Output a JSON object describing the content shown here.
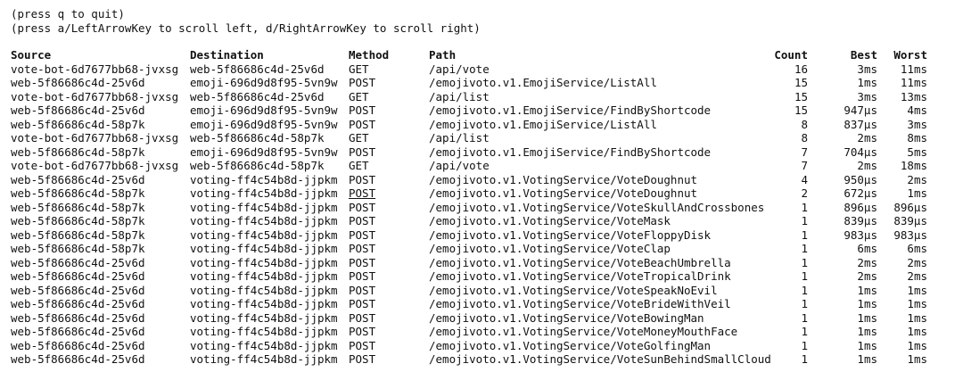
{
  "hints": [
    "(press q to quit)",
    "(press a/LeftArrowKey to scroll left, d/RightArrowKey to scroll right)"
  ],
  "headers": {
    "source": "Source",
    "destination": "Destination",
    "method": "Method",
    "path": "Path",
    "count": "Count",
    "best": "Best",
    "worst": "Worst"
  },
  "rows": [
    {
      "source": "vote-bot-6d7677bb68-jvxsg",
      "destination": "web-5f86686c4d-25v6d",
      "method": "GET",
      "path": "/api/vote",
      "count": "16",
      "best": "3ms",
      "worst": "11ms"
    },
    {
      "source": "web-5f86686c4d-25v6d",
      "destination": "emoji-696d9d8f95-5vn9w",
      "method": "POST",
      "path": "/emojivoto.v1.EmojiService/ListAll",
      "count": "15",
      "best": "1ms",
      "worst": "11ms"
    },
    {
      "source": "vote-bot-6d7677bb68-jvxsg",
      "destination": "web-5f86686c4d-25v6d",
      "method": "GET",
      "path": "/api/list",
      "count": "15",
      "best": "3ms",
      "worst": "13ms"
    },
    {
      "source": "web-5f86686c4d-25v6d",
      "destination": "emoji-696d9d8f95-5vn9w",
      "method": "POST",
      "path": "/emojivoto.v1.EmojiService/FindByShortcode",
      "count": "15",
      "best": "947µs",
      "worst": "4ms"
    },
    {
      "source": "web-5f86686c4d-58p7k",
      "destination": "emoji-696d9d8f95-5vn9w",
      "method": "POST",
      "path": "/emojivoto.v1.EmojiService/ListAll",
      "count": "8",
      "best": "837µs",
      "worst": "3ms"
    },
    {
      "source": "vote-bot-6d7677bb68-jvxsg",
      "destination": "web-5f86686c4d-58p7k",
      "method": "GET",
      "path": "/api/list",
      "count": "8",
      "best": "2ms",
      "worst": "8ms"
    },
    {
      "source": "web-5f86686c4d-58p7k",
      "destination": "emoji-696d9d8f95-5vn9w",
      "method": "POST",
      "path": "/emojivoto.v1.EmojiService/FindByShortcode",
      "count": "7",
      "best": "704µs",
      "worst": "5ms"
    },
    {
      "source": "vote-bot-6d7677bb68-jvxsg",
      "destination": "web-5f86686c4d-58p7k",
      "method": "GET",
      "path": "/api/vote",
      "count": "7",
      "best": "2ms",
      "worst": "18ms"
    },
    {
      "source": "web-5f86686c4d-25v6d",
      "destination": "voting-ff4c54b8d-jjpkm",
      "method": "POST",
      "path": "/emojivoto.v1.VotingService/VoteDoughnut",
      "count": "4",
      "best": "950µs",
      "worst": "2ms"
    },
    {
      "source": "web-5f86686c4d-58p7k",
      "destination": "voting-ff4c54b8d-jjpkm",
      "method": "POST",
      "path": "/emojivoto.v1.VotingService/VoteDoughnut",
      "count": "2",
      "best": "672µs",
      "worst": "1ms"
    },
    {
      "source": "web-5f86686c4d-58p7k",
      "destination": "voting-ff4c54b8d-jjpkm",
      "method": "POST",
      "path": "/emojivoto.v1.VotingService/VoteSkullAndCrossbones",
      "count": "1",
      "best": "896µs",
      "worst": "896µs"
    },
    {
      "source": "web-5f86686c4d-58p7k",
      "destination": "voting-ff4c54b8d-jjpkm",
      "method": "POST",
      "path": "/emojivoto.v1.VotingService/VoteMask",
      "count": "1",
      "best": "839µs",
      "worst": "839µs"
    },
    {
      "source": "web-5f86686c4d-58p7k",
      "destination": "voting-ff4c54b8d-jjpkm",
      "method": "POST",
      "path": "/emojivoto.v1.VotingService/VoteFloppyDisk",
      "count": "1",
      "best": "983µs",
      "worst": "983µs"
    },
    {
      "source": "web-5f86686c4d-58p7k",
      "destination": "voting-ff4c54b8d-jjpkm",
      "method": "POST",
      "path": "/emojivoto.v1.VotingService/VoteClap",
      "count": "1",
      "best": "6ms",
      "worst": "6ms"
    },
    {
      "source": "web-5f86686c4d-25v6d",
      "destination": "voting-ff4c54b8d-jjpkm",
      "method": "POST",
      "path": "/emojivoto.v1.VotingService/VoteBeachUmbrella",
      "count": "1",
      "best": "2ms",
      "worst": "2ms"
    },
    {
      "source": "web-5f86686c4d-25v6d",
      "destination": "voting-ff4c54b8d-jjpkm",
      "method": "POST",
      "path": "/emojivoto.v1.VotingService/VoteTropicalDrink",
      "count": "1",
      "best": "2ms",
      "worst": "2ms"
    },
    {
      "source": "web-5f86686c4d-25v6d",
      "destination": "voting-ff4c54b8d-jjpkm",
      "method": "POST",
      "path": "/emojivoto.v1.VotingService/VoteSpeakNoEvil",
      "count": "1",
      "best": "1ms",
      "worst": "1ms"
    },
    {
      "source": "web-5f86686c4d-25v6d",
      "destination": "voting-ff4c54b8d-jjpkm",
      "method": "POST",
      "path": "/emojivoto.v1.VotingService/VoteBrideWithVeil",
      "count": "1",
      "best": "1ms",
      "worst": "1ms"
    },
    {
      "source": "web-5f86686c4d-25v6d",
      "destination": "voting-ff4c54b8d-jjpkm",
      "method": "POST",
      "path": "/emojivoto.v1.VotingService/VoteBowingMan",
      "count": "1",
      "best": "1ms",
      "worst": "1ms"
    },
    {
      "source": "web-5f86686c4d-25v6d",
      "destination": "voting-ff4c54b8d-jjpkm",
      "method": "POST",
      "path": "/emojivoto.v1.VotingService/VoteMoneyMouthFace",
      "count": "1",
      "best": "1ms",
      "worst": "1ms"
    },
    {
      "source": "web-5f86686c4d-25v6d",
      "destination": "voting-ff4c54b8d-jjpkm",
      "method": "POST",
      "path": "/emojivoto.v1.VotingService/VoteGolfingMan",
      "count": "1",
      "best": "1ms",
      "worst": "1ms"
    },
    {
      "source": "web-5f86686c4d-25v6d",
      "destination": "voting-ff4c54b8d-jjpkm",
      "method": "POST",
      "path": "/emojivoto.v1.VotingService/VoteSunBehindSmallCloud",
      "count": "1",
      "best": "1ms",
      "worst": "1ms"
    }
  ]
}
